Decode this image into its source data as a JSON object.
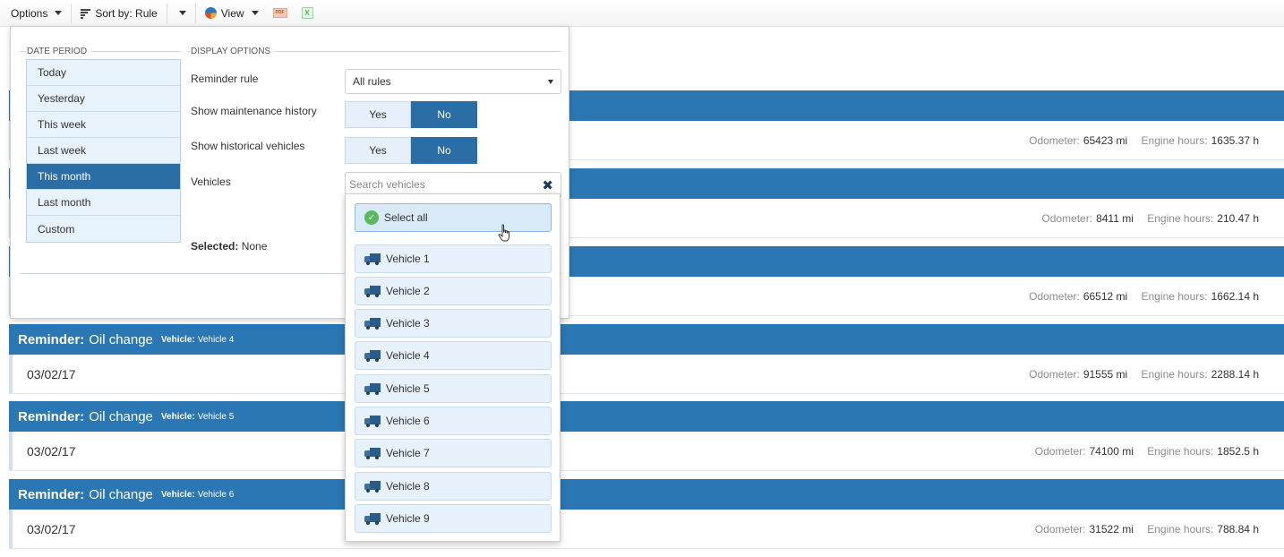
{
  "toolbar": {
    "options_label": "Options",
    "sort_label": "Sort by: Rule",
    "view_label": "View",
    "pdf_icon": "PDF",
    "xls_icon": "X"
  },
  "panel": {
    "date_period_legend": "DATE PERIOD",
    "display_options_legend": "DISPLAY OPTIONS",
    "periods": [
      "Today",
      "Yesterday",
      "This week",
      "Last week",
      "This month",
      "Last month",
      "Custom"
    ],
    "active_period": "This month",
    "reminder_rule_label": "Reminder rule",
    "reminder_rule_value": "All rules",
    "maint_history_label": "Show maintenance history",
    "hist_vehicles_label": "Show historical vehicles",
    "yes_label": "Yes",
    "no_label": "No",
    "vehicles_label": "Vehicles",
    "search_placeholder": "Search vehicles",
    "selected_label": "Selected:",
    "selected_value": "None"
  },
  "vehicle_dropdown": {
    "select_all": "Select all",
    "vehicles": [
      "Vehicle 1",
      "Vehicle 2",
      "Vehicle 3",
      "Vehicle 4",
      "Vehicle 5",
      "Vehicle 6",
      "Vehicle 7",
      "Vehicle 8",
      "Vehicle 9"
    ]
  },
  "reminders": {
    "reminder_label": "Reminder:",
    "vehicle_label": "Vehicle:",
    "odometer_label": "Odometer:",
    "engine_hours_label": "Engine hours:",
    "items": [
      {
        "rule": "",
        "vehicle": "",
        "date": "",
        "odometer": "65423 mi",
        "engine_hours": "1635.37 h"
      },
      {
        "rule": "",
        "vehicle": "",
        "date": "",
        "odometer": "8411 mi",
        "engine_hours": "210.47 h"
      },
      {
        "rule": "",
        "vehicle": "",
        "date": "",
        "odometer": "66512 mi",
        "engine_hours": "1662.14 h"
      },
      {
        "rule": "Oil change",
        "vehicle": "Vehicle 4",
        "date": "03/02/17",
        "odometer": "91555 mi",
        "engine_hours": "2288.14 h"
      },
      {
        "rule": "Oil change",
        "vehicle": "Vehicle 5",
        "date": "03/02/17",
        "odometer": "74100 mi",
        "engine_hours": "1852.5 h"
      },
      {
        "rule": "Oil change",
        "vehicle": "Vehicle 6",
        "date": "03/02/17",
        "odometer": "31522 mi",
        "engine_hours": "788.84 h"
      }
    ]
  },
  "colors": {
    "accent": "#2b77b3",
    "active_period": "#2b6ea5",
    "list_item_bg": "#e6f1fb"
  }
}
